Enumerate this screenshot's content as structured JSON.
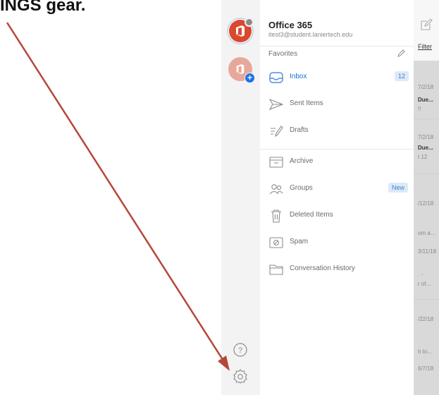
{
  "caption": "INGS gear.",
  "account": {
    "name": "Office 365",
    "email": "itest3@student.laniertech.edu"
  },
  "favorites_label": "Favorites",
  "folders": [
    {
      "label": "Inbox",
      "badge": "12",
      "active": true
    },
    {
      "label": "Sent Items"
    },
    {
      "label": "Drafts"
    },
    {
      "label": "Archive"
    },
    {
      "label": "Groups",
      "badge": "New"
    },
    {
      "label": "Deleted Items"
    },
    {
      "label": "Spam"
    },
    {
      "label": "Conversation History"
    }
  ],
  "right_peek": {
    "filter": "Filter",
    "texts": [
      "7/2/18",
      "Due...",
      "!!",
      "7/2/18",
      "Due...",
      "t 12",
      "/12/18",
      "om a...",
      "3/11/18",
      ". -",
      "r of...",
      "/22/18",
      "h to...",
      "6/7/18"
    ]
  },
  "colors": {
    "accent": "#1f6fd1",
    "office_red": "#d9492e",
    "arrow": "#b5473a"
  }
}
